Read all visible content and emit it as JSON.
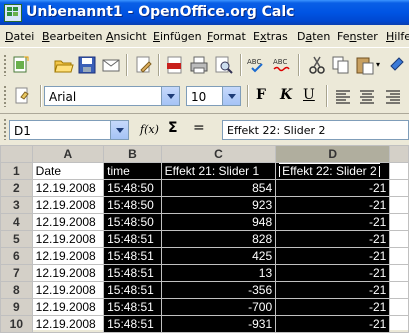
{
  "window": {
    "title": "Unbenannt1 - OpenOffice.org Calc"
  },
  "menu": [
    {
      "label": "Datei",
      "accel": "D"
    },
    {
      "label": "Bearbeiten",
      "accel": "B"
    },
    {
      "label": "Ansicht",
      "accel": "A"
    },
    {
      "label": "Einfügen",
      "accel": "E"
    },
    {
      "label": "Format",
      "accel": "F"
    },
    {
      "label": "Extras",
      "accel": "x"
    },
    {
      "label": "Daten",
      "accel": "a"
    },
    {
      "label": "Fenster",
      "accel": "n"
    },
    {
      "label": "Hilfe",
      "accel": "H"
    }
  ],
  "toolbar": {
    "icons": [
      "new-document-icon",
      "open-folder-icon",
      "save-icon",
      "email-icon",
      "edit-file-icon",
      "export-pdf-icon",
      "print-icon",
      "page-preview-icon",
      "spellcheck-icon",
      "autospellcheck-icon",
      "cut-icon",
      "copy-icon",
      "paste-icon"
    ]
  },
  "format": {
    "font_name": "Arial",
    "font_size": "10",
    "bold_label": "F",
    "italic_label": "K",
    "underline_label": "U"
  },
  "formula": {
    "cell_ref": "D1",
    "function_label": "f(x)",
    "sum_label": "Σ",
    "equals_label": "=",
    "content": "Effekt 22: Slider 2"
  },
  "sheet": {
    "columns": [
      "A",
      "B",
      "C",
      "D"
    ],
    "selected_column": "D",
    "rows": [
      {
        "n": "1",
        "a": "Date",
        "b": "time",
        "c": "Effekt 21: Slider 1",
        "d": "Effekt 22: Slider 2"
      },
      {
        "n": "2",
        "a": "12.19.2008",
        "b": "15:48:50",
        "c": "854",
        "d": "-21"
      },
      {
        "n": "3",
        "a": "12.19.2008",
        "b": "15:48:50",
        "c": "923",
        "d": "-21"
      },
      {
        "n": "4",
        "a": "12.19.2008",
        "b": "15:48:50",
        "c": "948",
        "d": "-21"
      },
      {
        "n": "5",
        "a": "12.19.2008",
        "b": "15:48:51",
        "c": "828",
        "d": "-21"
      },
      {
        "n": "6",
        "a": "12.19.2008",
        "b": "15:48:51",
        "c": "425",
        "d": "-21"
      },
      {
        "n": "7",
        "a": "12.19.2008",
        "b": "15:48:51",
        "c": "13",
        "d": "-21"
      },
      {
        "n": "8",
        "a": "12.19.2008",
        "b": "15:48:51",
        "c": "-356",
        "d": "-21"
      },
      {
        "n": "9",
        "a": "12.19.2008",
        "b": "15:48:51",
        "c": "-700",
        "d": "-21"
      },
      {
        "n": "10",
        "a": "12.19.2008",
        "b": "15:48:51",
        "c": "-931",
        "d": "-21"
      }
    ]
  },
  "colors": {
    "titlebar": "#0054e3",
    "chrome": "#ece9d8",
    "selection": "#000000"
  }
}
